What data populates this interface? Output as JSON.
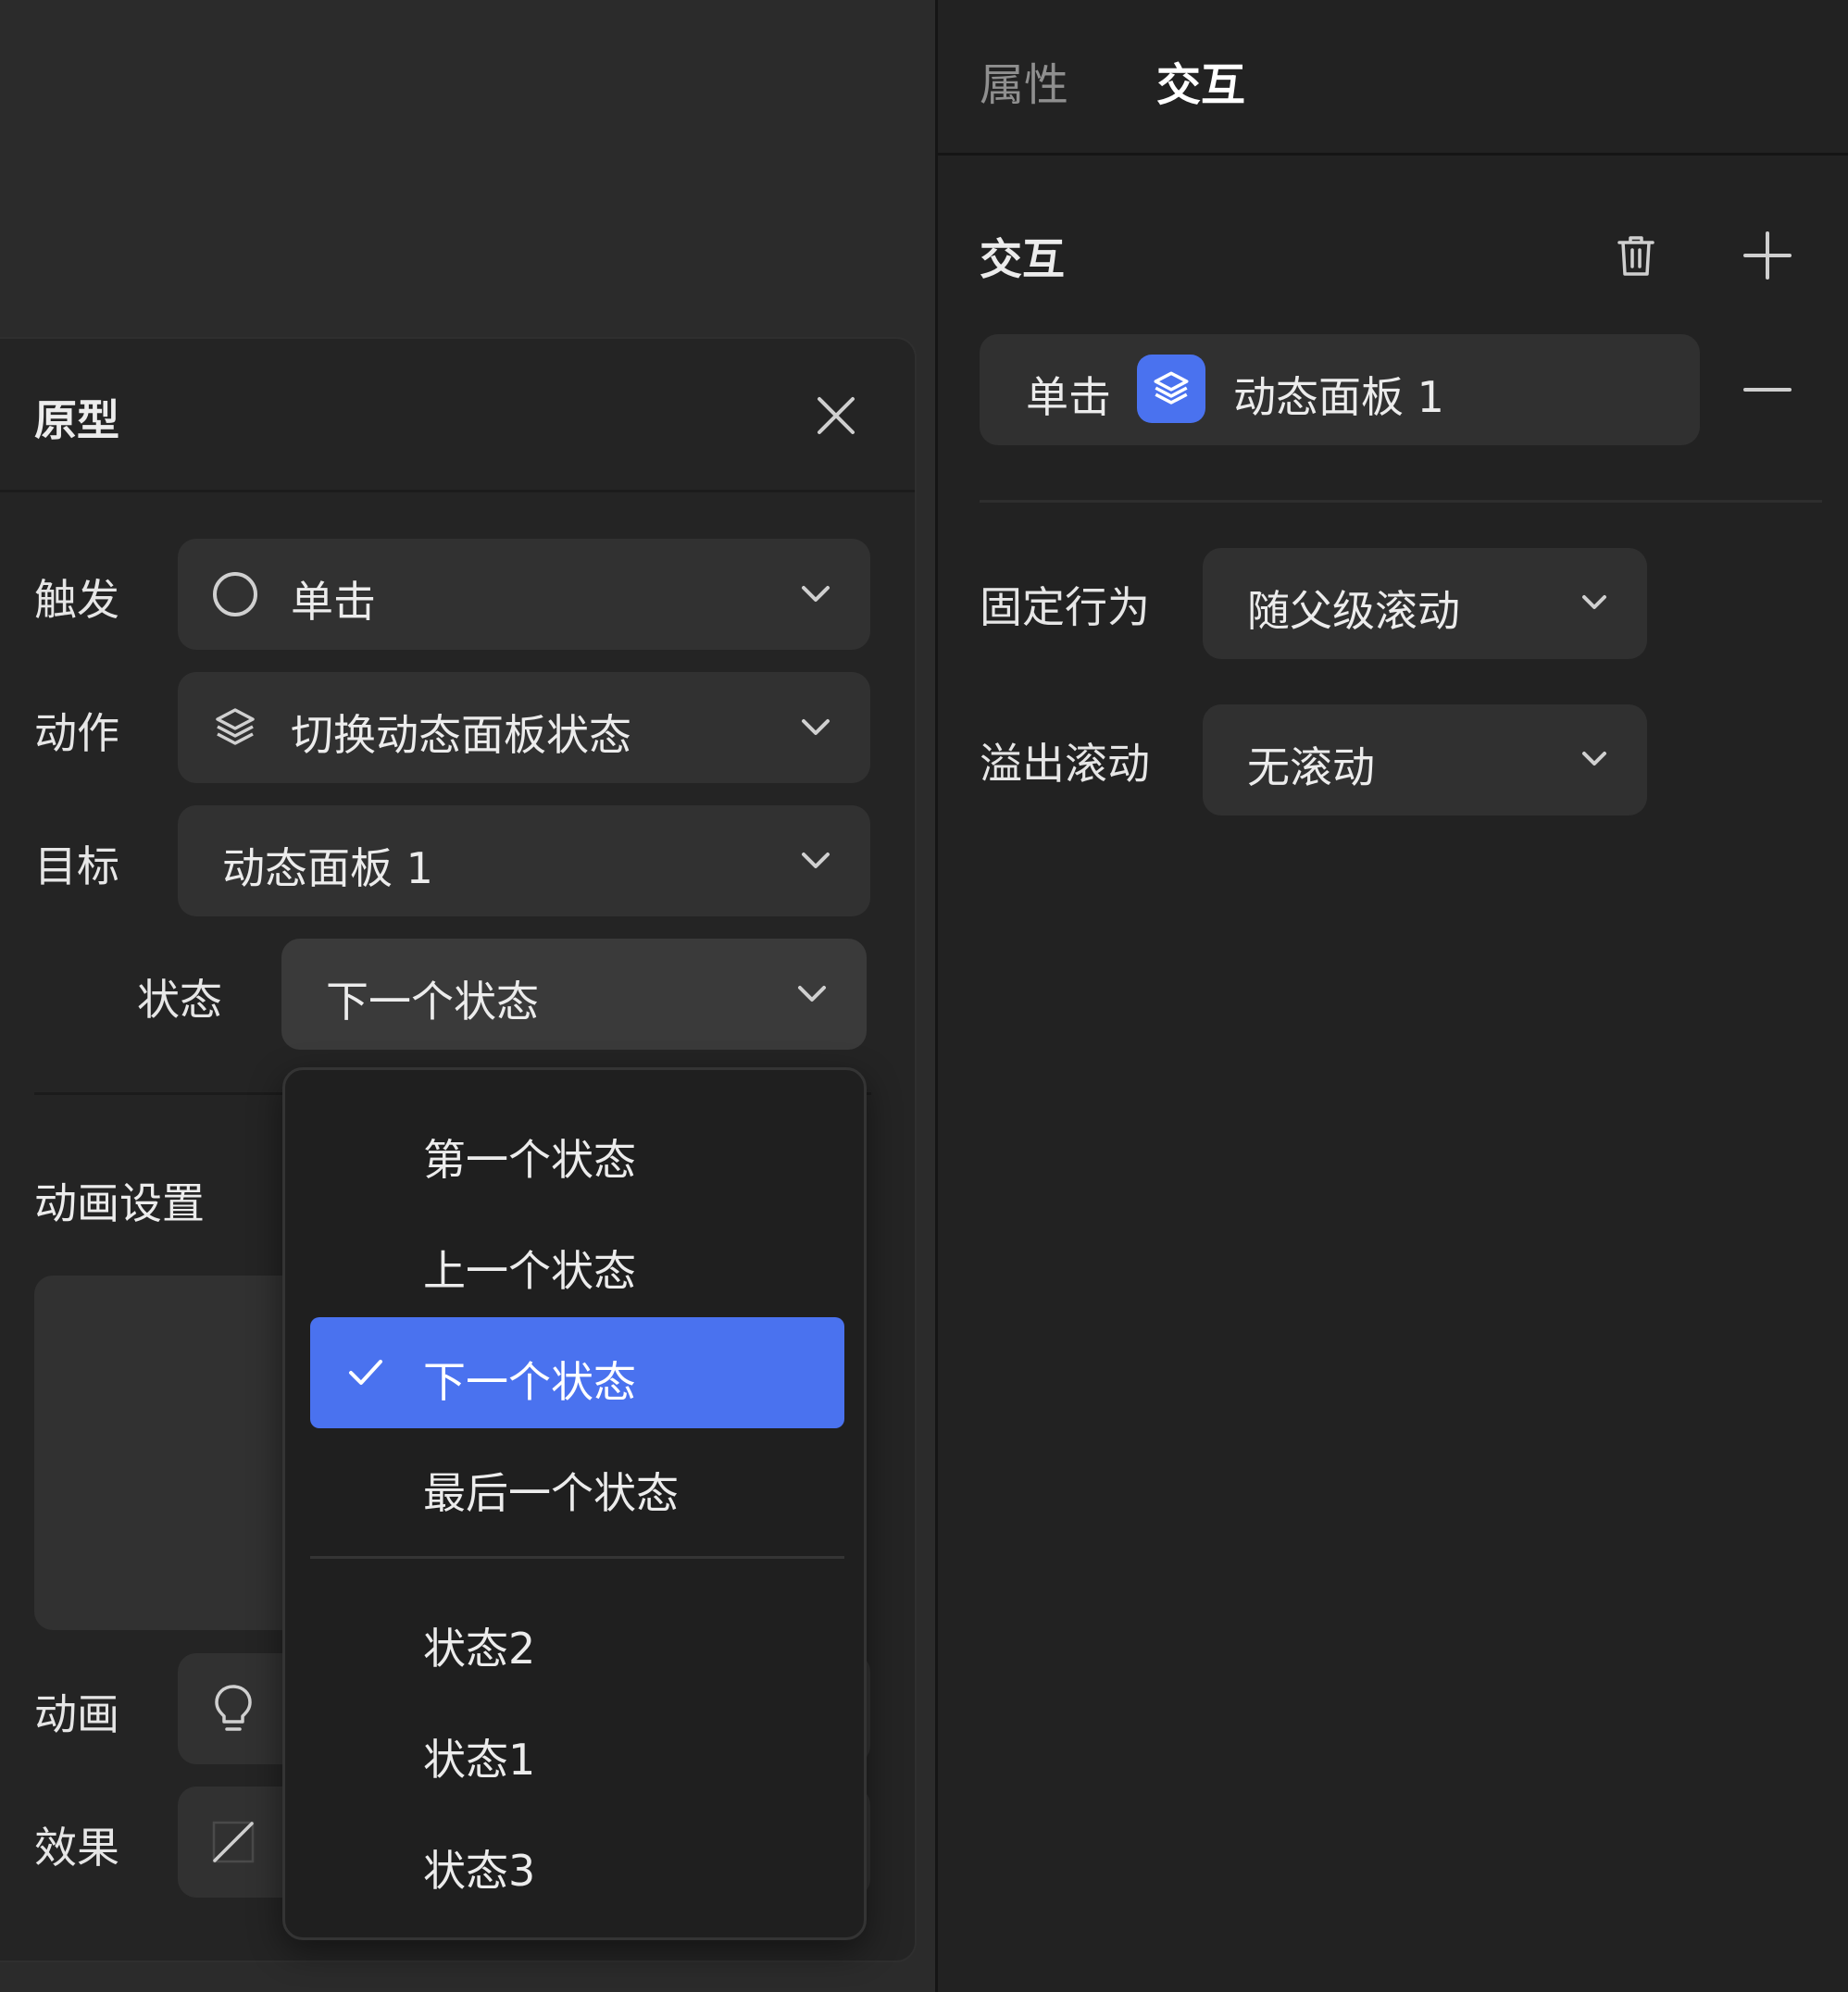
{
  "prototype_panel": {
    "title": "原型",
    "trigger": {
      "label": "触发",
      "value": "单击",
      "icon": "circle-icon"
    },
    "action": {
      "label": "动作",
      "value": "切换动态面板状态",
      "icon": "layers-icon"
    },
    "target": {
      "label": "目标",
      "value": "动态面板 1"
    },
    "state": {
      "label": "状态",
      "value": "下一个状态"
    },
    "animation_settings": {
      "title": "动画设置"
    },
    "animation": {
      "label": "动画",
      "icon": "lightbulb-icon"
    },
    "effect": {
      "label": "效果",
      "icon": "linear-curve-icon"
    }
  },
  "state_dropdown": {
    "items": [
      {
        "label": "第一个状态",
        "selected": false
      },
      {
        "label": "上一个状态",
        "selected": false
      },
      {
        "label": "下一个状态",
        "selected": true
      },
      {
        "label": "最后一个状态",
        "selected": false
      },
      {
        "label": "状态2",
        "selected": false
      },
      {
        "label": "状态1",
        "selected": false
      },
      {
        "label": "状态3",
        "selected": false
      }
    ]
  },
  "right_panel": {
    "tabs": [
      {
        "label": "属性",
        "active": false
      },
      {
        "label": "交互",
        "active": true
      }
    ],
    "interaction_section": {
      "title": "交互",
      "card": {
        "trigger": "单击",
        "target": "动态面板 1",
        "icon": "layers-icon"
      }
    },
    "fixed_behavior": {
      "label": "固定行为",
      "value": "随父级滚动"
    },
    "overflow_scroll": {
      "label": "溢出滚动",
      "value": "无滚动"
    }
  },
  "colors": {
    "accent": "#4a72ef",
    "panel_bg": "#242424",
    "field_bg": "#313131"
  }
}
